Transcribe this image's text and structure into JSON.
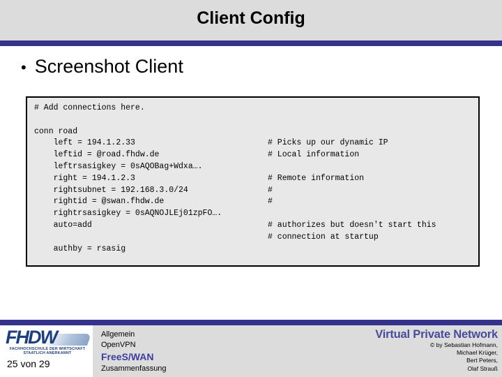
{
  "header": {
    "title": "Client Config",
    "band_color": "#dcdcdc",
    "rule_color": "#33338c"
  },
  "body": {
    "bullet_marker": "•",
    "bullet_text": "Screenshot Client"
  },
  "code_box": {
    "background": "#e8e8e8",
    "border_color": "#000000",
    "left_column": [
      "# Add connections here.",
      "",
      "conn road",
      "    left = 194.1.2.33",
      "    leftid = @road.fhdw.de",
      "    leftrsasigkey = 0sAQOBag+Wdxa….",
      "    right = 194.1.2.3",
      "    rightsubnet = 192.168.3.0/24",
      "    rightid = @swan.fhdw.de",
      "    rightrsasigkey = 0sAQNOJLEj01zpFO….",
      "    auto=add",
      "",
      "    authby = rsasig"
    ],
    "right_column": [
      "",
      "",
      "",
      "# Picks up our dynamic IP",
      "# Local information",
      "",
      "# Remote information",
      "#",
      "#",
      "",
      "# authorizes but doesn't start this",
      "# connection at startup",
      ""
    ]
  },
  "footer": {
    "rule_color": "#33338c",
    "background": "#dcdcdc",
    "logo": {
      "wordmark": "FHDW",
      "subtitle_line1": "FACHHOCHSCHULE DER WIRTSCHAFT",
      "subtitle_line2": "STAATLICH ANERKANNT",
      "color": "#1f3f7a"
    },
    "page_number": "25 von 29",
    "nav_items": [
      {
        "label": "Allgemein",
        "active": false
      },
      {
        "label": "OpenVPN",
        "active": false
      },
      {
        "label": "FreeS/WAN",
        "active": true
      },
      {
        "label": "Zusammenfassung",
        "active": false
      }
    ],
    "presentation_title": "Virtual Private Network",
    "presentation_title_color": "#4a4a9c",
    "credits": [
      "© by Sebastian Hofmann,",
      "Michael Krüger,",
      "Bert Peters,",
      "Olaf Strauß"
    ]
  }
}
